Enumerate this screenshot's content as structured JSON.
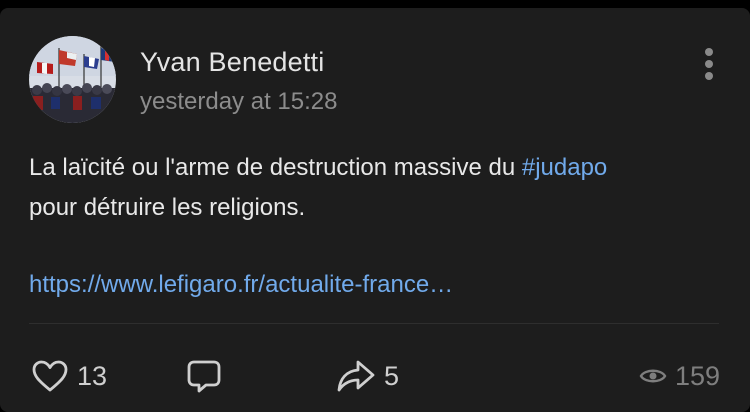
{
  "post": {
    "author": "Yvan Benedetti",
    "timestamp": "yesterday at 15:28",
    "text_line1": "La laïcité ou l'arme de destruction massive du ",
    "hashtag": "#judapo",
    "text_line2": "pour détruire les religions.",
    "link": "https://www.lefigaro.fr/actualite-france…"
  },
  "actions": {
    "likes": "13",
    "shares": "5",
    "views": "159"
  },
  "icons": {
    "avatar": "avatar-flags-crowd-photo",
    "more": "more-vertical-icon",
    "like": "heart-icon",
    "comment": "comment-icon",
    "share": "share-arrow-icon",
    "views": "eye-icon"
  },
  "colors": {
    "background": "#1d1d1d",
    "link": "#71aaeb",
    "text": "#e8e8e8",
    "muted": "#8c8c8c"
  }
}
